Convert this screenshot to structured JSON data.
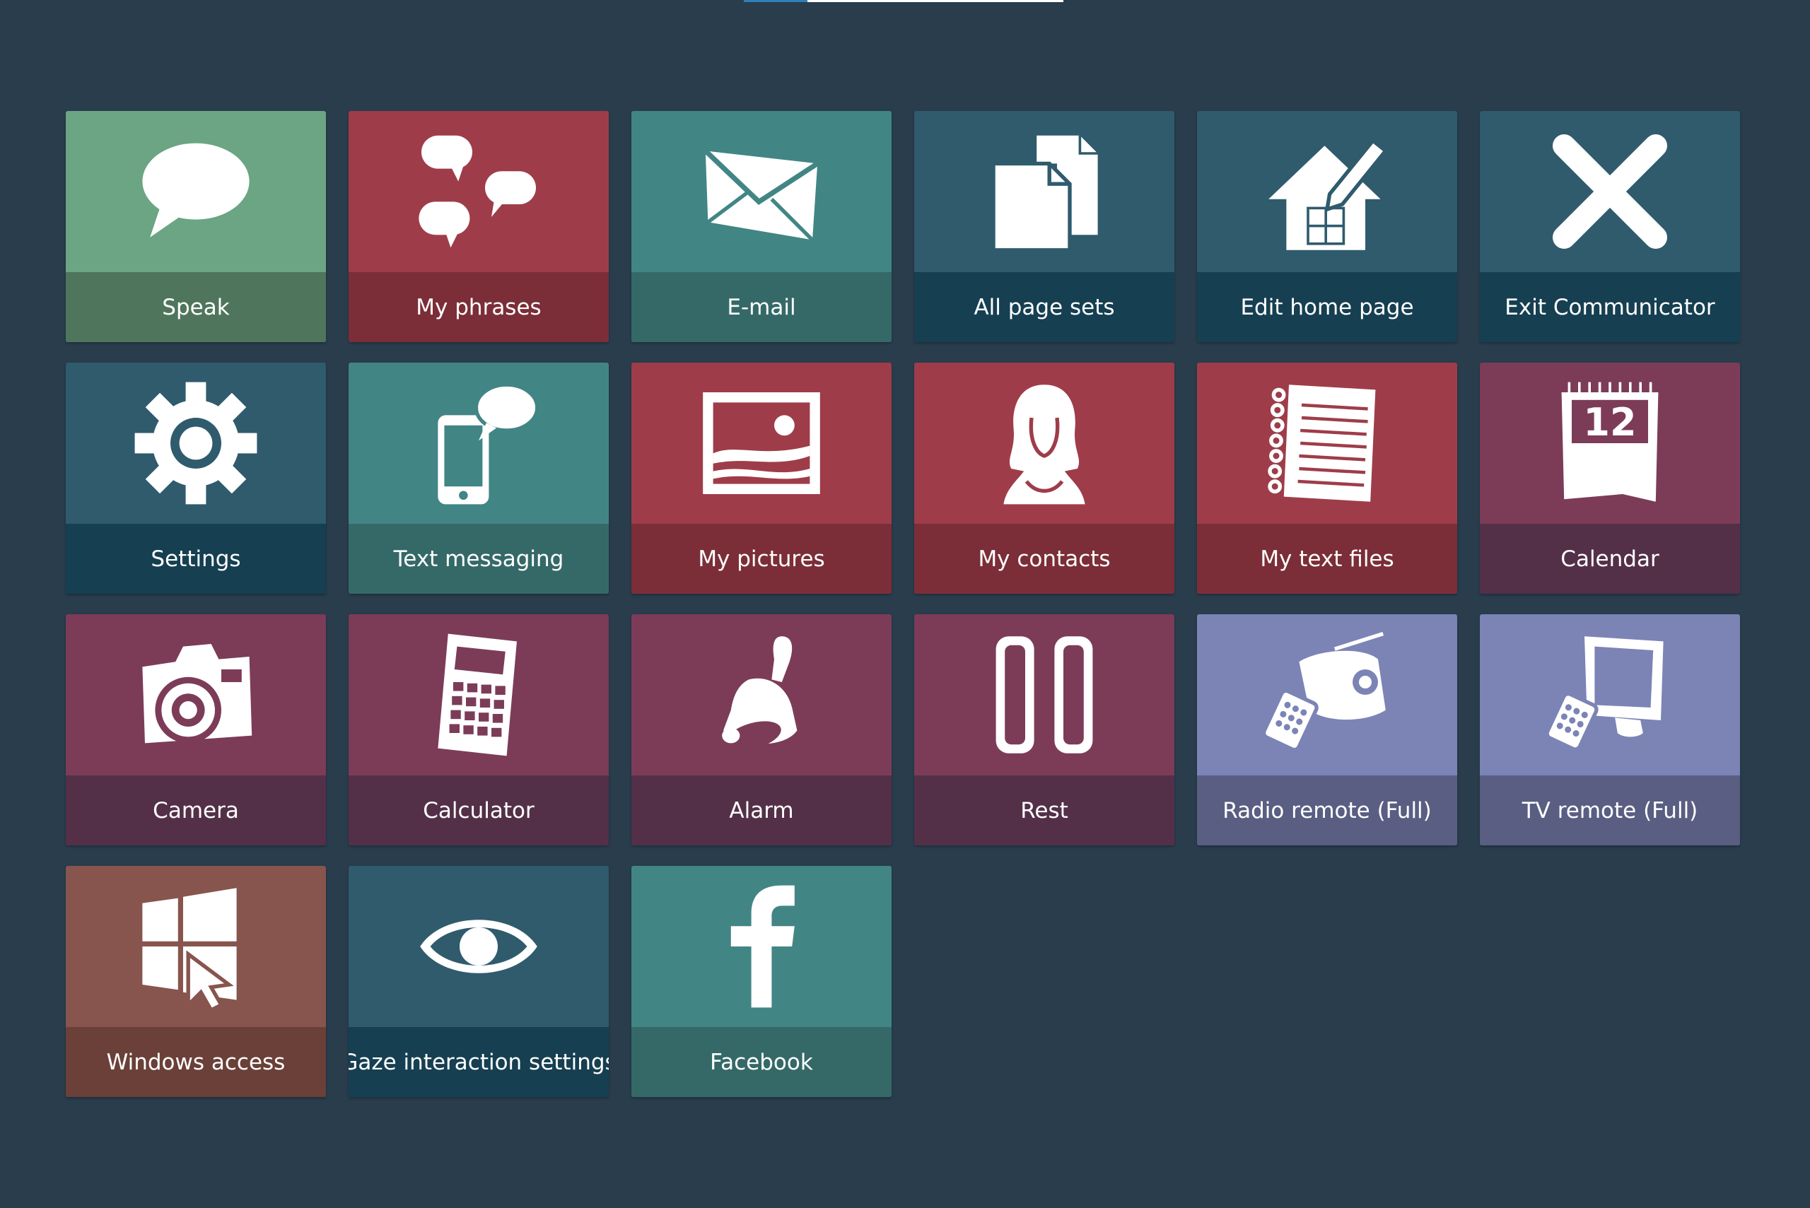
{
  "progress": {
    "fraction": 0.2
  },
  "tiles": [
    {
      "label": "Speak",
      "icon": "speech-bubble-icon",
      "color": "green"
    },
    {
      "label": "My phrases",
      "icon": "chat-bubbles-icon",
      "color": "red"
    },
    {
      "label": "E-mail",
      "icon": "envelope-icon",
      "color": "teal"
    },
    {
      "label": "All page sets",
      "icon": "documents-icon",
      "color": "navy"
    },
    {
      "label": "Edit home page",
      "icon": "house-pencil-icon",
      "color": "navy"
    },
    {
      "label": "Exit Communicator",
      "icon": "close-icon",
      "color": "navy"
    },
    {
      "label": "Settings",
      "icon": "gear-icon",
      "color": "navy"
    },
    {
      "label": "Text messaging",
      "icon": "phone-chat-icon",
      "color": "teal"
    },
    {
      "label": "My pictures",
      "icon": "picture-icon",
      "color": "red"
    },
    {
      "label": "My contacts",
      "icon": "person-icon",
      "color": "red"
    },
    {
      "label": "My text files",
      "icon": "notebook-icon",
      "color": "red"
    },
    {
      "label": "Calendar",
      "icon": "calendar-icon",
      "color": "plum",
      "icon_text": "12"
    },
    {
      "label": "Camera",
      "icon": "camera-icon",
      "color": "plum"
    },
    {
      "label": "Calculator",
      "icon": "calculator-icon",
      "color": "plum"
    },
    {
      "label": "Alarm",
      "icon": "bell-icon",
      "color": "plum"
    },
    {
      "label": "Rest",
      "icon": "pause-icon",
      "color": "plum"
    },
    {
      "label": "Radio remote (Full)",
      "icon": "radio-remote-icon",
      "color": "lavender"
    },
    {
      "label": "TV remote (Full)",
      "icon": "tv-remote-icon",
      "color": "lavender"
    },
    {
      "label": "Windows access",
      "icon": "windows-cursor-icon",
      "color": "brown"
    },
    {
      "label": "Gaze interaction settings",
      "icon": "eye-icon",
      "color": "navy"
    },
    {
      "label": "Facebook",
      "icon": "facebook-icon",
      "color": "teal"
    }
  ]
}
